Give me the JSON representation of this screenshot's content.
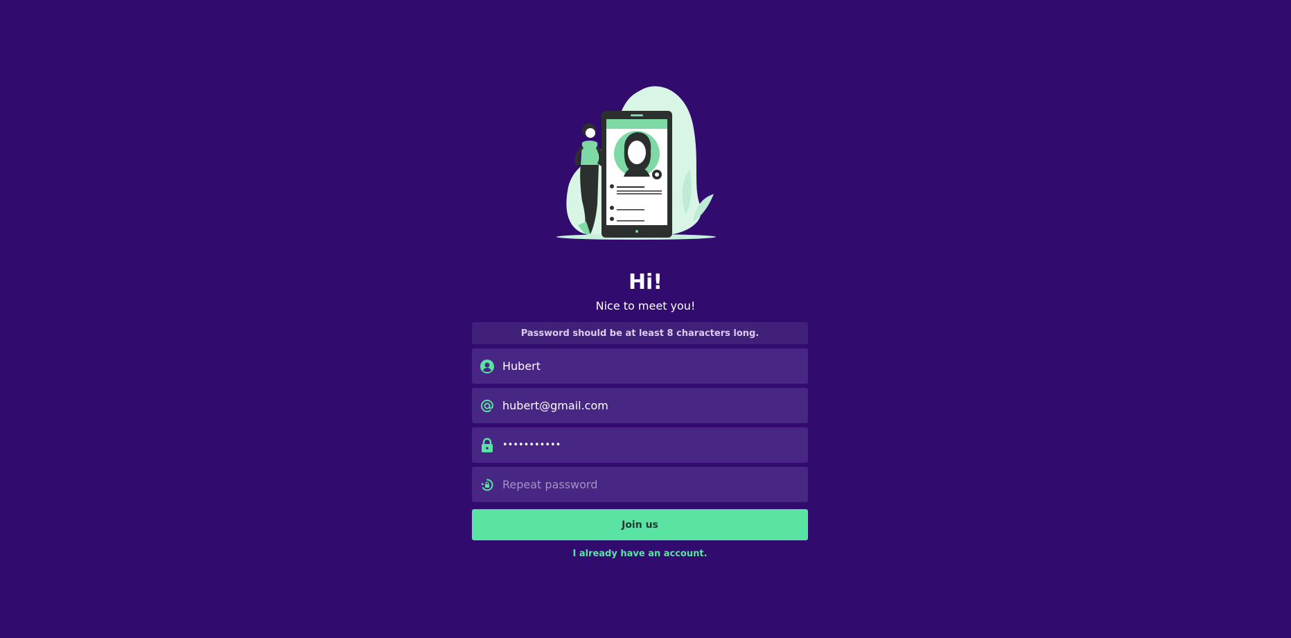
{
  "header": {
    "title": "Hi!",
    "subtitle": "Nice to meet you!"
  },
  "form": {
    "notice": "Password should be at least 8 characters long.",
    "name_field": {
      "icon": "user-circle-icon",
      "value": "Hubert"
    },
    "email_field": {
      "icon": "at-sign-icon",
      "value": "hubert@gmail.com"
    },
    "password_field": {
      "icon": "lock-icon",
      "value": "•••••••••••"
    },
    "repeat_password_field": {
      "icon": "lock-reset-icon",
      "placeholder": "Repeat password",
      "value": ""
    },
    "submit_label": "Join us",
    "login_link": "I already have an account."
  },
  "colors": {
    "background": "#310c6e",
    "field_background": "#482684",
    "accent": "#5be3a3"
  }
}
